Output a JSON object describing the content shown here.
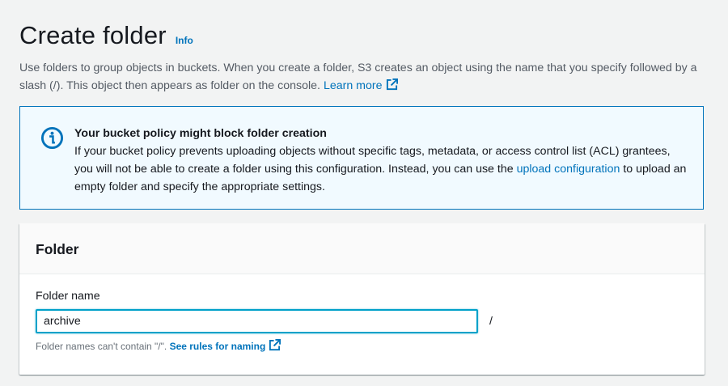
{
  "header": {
    "title": "Create folder",
    "info_label": "Info"
  },
  "description": {
    "text": "Use folders to group objects in buckets. When you create a folder, S3 creates an object using the name that you specify followed by a slash (/). This object then appears as folder on the console.",
    "learn_more": "Learn more"
  },
  "alert": {
    "icon": "info-circle-icon",
    "title": "Your bucket policy might block folder creation",
    "text_before": "If your bucket policy prevents uploading objects without specific tags, metadata, or access control list (ACL) grantees, you will not be able to create a folder using this configuration. Instead, you can use the",
    "link": "upload configuration",
    "text_after": "to upload an empty folder and specify the appropriate settings."
  },
  "panel": {
    "title": "Folder",
    "field_label": "Folder name",
    "input_value": "archive",
    "suffix": "/",
    "hint_text": "Folder names can't contain \"/\".",
    "hint_link": "See rules for naming"
  },
  "colors": {
    "background": "#f2f3f3",
    "link": "#0073bb",
    "alert_bg": "#f1faff",
    "focus": "#00a1c9"
  }
}
